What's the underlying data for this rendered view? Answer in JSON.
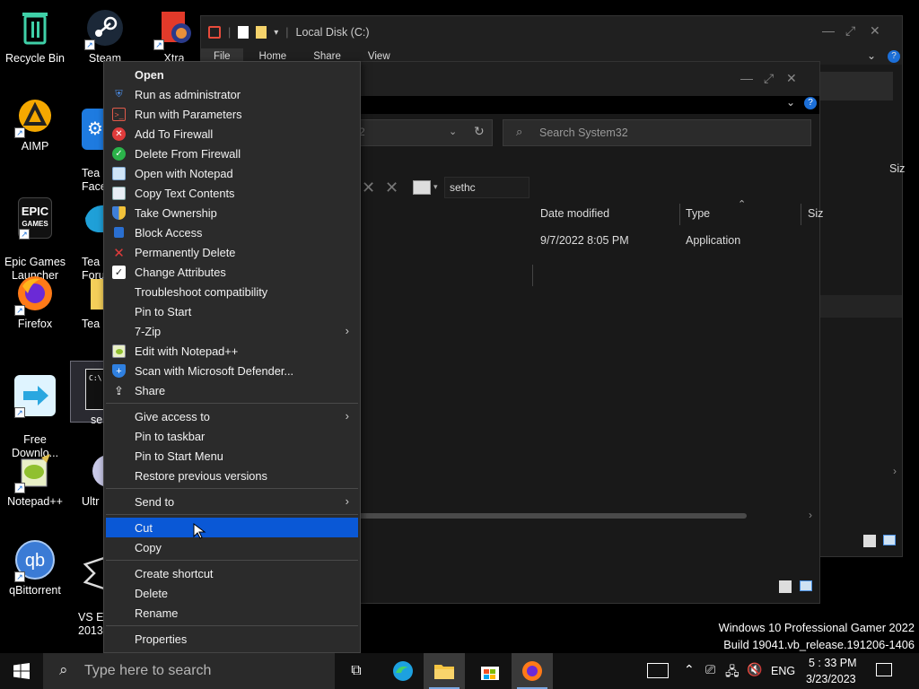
{
  "desktop": {
    "icons": [
      {
        "label": "Recycle Bin"
      },
      {
        "label": "Steam"
      },
      {
        "label": "Xtra"
      },
      {
        "label": "AIMP"
      },
      {
        "label": "Tea\nFace"
      },
      {
        "label": "Epic Games\nLauncher"
      },
      {
        "label": "Tea\nForu"
      },
      {
        "label": "Firefox"
      },
      {
        "label": "Tea"
      },
      {
        "label": "Free\nDownlo..."
      },
      {
        "label": "se"
      },
      {
        "label": "Notepad++"
      },
      {
        "label": "Ultr"
      },
      {
        "label": "qBittorrent"
      },
      {
        "label": "VS Ex\n2013"
      }
    ]
  },
  "explorer_back": {
    "title": "Local Disk (C:)",
    "tabs": [
      "File",
      "Home",
      "Share",
      "View"
    ],
    "col_size": "Siz"
  },
  "explorer_front": {
    "search_placeholder": "Search System32",
    "addr_fragment": "2",
    "filter_text": "sethc",
    "columns": {
      "date": "Date modified",
      "type": "Type",
      "size": "Siz"
    },
    "row": {
      "date": "9/7/2022 8:05 PM",
      "type": "Application"
    }
  },
  "context_menu": {
    "items": [
      {
        "label": "Open",
        "icon": "none",
        "bold": true
      },
      {
        "label": "Run as administrator",
        "icon": "shield-icon"
      },
      {
        "label": "Run with Parameters",
        "icon": "terminal-icon"
      },
      {
        "label": "Add To Firewall",
        "icon": "red-x-circle-icon"
      },
      {
        "label": "Delete From Firewall",
        "icon": "green-check-circle-icon"
      },
      {
        "label": "Open with Notepad",
        "icon": "notepad-icon"
      },
      {
        "label": "Copy Text Contents",
        "icon": "copy-text-icon"
      },
      {
        "label": "Take Ownership",
        "icon": "uac-shield-icon"
      },
      {
        "label": "Block Access",
        "icon": "block-icon"
      },
      {
        "label": "Permanently Delete",
        "icon": "red-x-icon"
      },
      {
        "label": "Change Attributes",
        "icon": "checkbox-icon"
      },
      {
        "label": "Troubleshoot compatibility",
        "icon": "none"
      },
      {
        "label": "Pin to Start",
        "icon": "none"
      },
      {
        "label": "7-Zip",
        "icon": "none",
        "submenu": true
      },
      {
        "label": "Edit with Notepad++",
        "icon": "notepadpp-icon"
      },
      {
        "label": "Scan with Microsoft Defender...",
        "icon": "defender-icon"
      },
      {
        "label": "Share",
        "icon": "share-icon"
      },
      {
        "label": "Give access to",
        "icon": "none",
        "submenu": true
      },
      {
        "label": "Pin to taskbar",
        "icon": "none"
      },
      {
        "label": "Pin to Start Menu",
        "icon": "none"
      },
      {
        "label": "Restore previous versions",
        "icon": "none"
      },
      {
        "label": "Send to",
        "icon": "none",
        "submenu": true
      },
      {
        "label": "Cut",
        "icon": "none",
        "highlighted": true
      },
      {
        "label": "Copy",
        "icon": "none"
      },
      {
        "label": "Create shortcut",
        "icon": "none"
      },
      {
        "label": "Delete",
        "icon": "none"
      },
      {
        "label": "Rename",
        "icon": "none"
      },
      {
        "label": "Properties",
        "icon": "none"
      }
    ],
    "submenu_arrow": "›"
  },
  "watermark": {
    "line1": "Windows 10 Professional Gamer 2022",
    "line2": "Build 19041.vb_release.191206-1406"
  },
  "taskbar": {
    "search_placeholder": "Type here to search",
    "language": "ENG",
    "time": "5 : 33 PM",
    "date": "3/23/2023"
  },
  "colors": {
    "menu_bg": "#2b2b2b",
    "highlight": "#0a58d6",
    "taskbar_bg": "#121212"
  }
}
